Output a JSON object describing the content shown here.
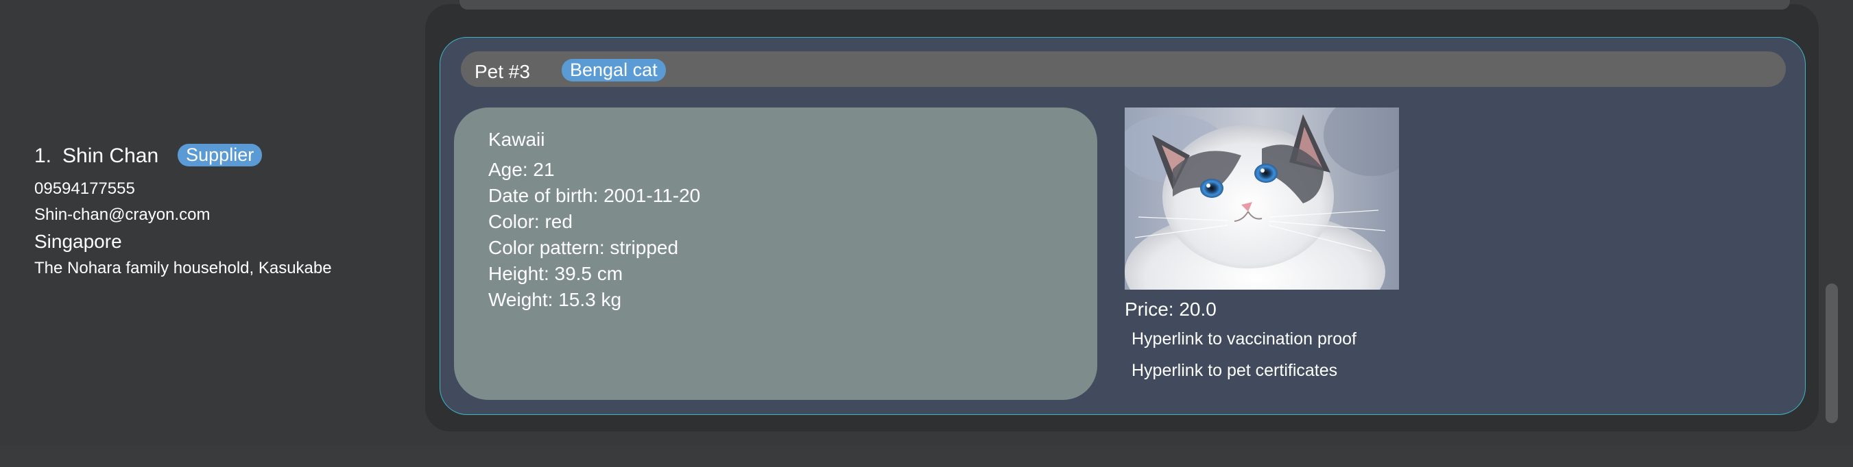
{
  "contact": {
    "index": "1.",
    "name": "Shin Chan",
    "tag": "Supplier",
    "phone": "09594177555",
    "email": "Shin-chan@crayon.com",
    "city": "Singapore",
    "address": "The Nohara family household, Kasukabe"
  },
  "pet": {
    "number": "Pet #3",
    "breed_tag": "Bengal cat",
    "name": "Kawaii",
    "age": "Age: 21",
    "dob": "Date of birth: 2001-11-20",
    "color": "Color: red",
    "pattern": "Color pattern: stripped",
    "height": "Height: 39.5 cm",
    "weight": "Weight: 15.3 kg",
    "price": "Price: 20.0",
    "vaccination_link": "Hyperlink to vaccination proof",
    "certificates_link": "Hyperlink to pet certificates",
    "photo": "white and grey blue-eyed cat photo"
  },
  "colors": {
    "background": "#38393a",
    "card": "#414b5d",
    "card_border": "#3fb6c6",
    "tag": "#5b9bd5",
    "info_box": "#7f8c8c",
    "header_bar": "#646464"
  }
}
